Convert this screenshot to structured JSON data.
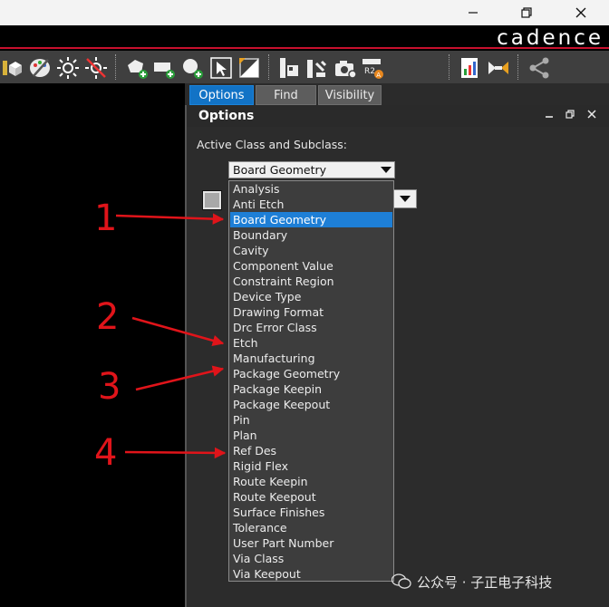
{
  "brand": "cadence",
  "tabs": [
    {
      "label": "Options",
      "active": true
    },
    {
      "label": "Find",
      "active": false
    },
    {
      "label": "Visibility",
      "active": false
    }
  ],
  "panel": {
    "title": "Options",
    "active_class_label": "Active Class and Subclass:",
    "class_value": "Board Geometry"
  },
  "dropdown_items": [
    "Analysis",
    "Anti Etch",
    "Board Geometry",
    "Boundary",
    "Cavity",
    "Component Value",
    "Constraint Region",
    "Device Type",
    "Drawing Format",
    "Drc Error Class",
    "Etch",
    "Manufacturing",
    "Package Geometry",
    "Package Keepin",
    "Package Keepout",
    "Pin",
    "Plan",
    "Ref Des",
    "Rigid Flex",
    "Route Keepin",
    "Route Keepout",
    "Surface Finishes",
    "Tolerance",
    "User Part Number",
    "Via Class",
    "Via Keepout"
  ],
  "selected_index": 2,
  "annotations": [
    "1",
    "2",
    "3",
    "4"
  ],
  "watermark": "公众号 · 子正电子科技",
  "colors": {
    "accent": "#1e7fd6",
    "annotation": "#e0141a",
    "brand_line": "#c8102e"
  },
  "icons": [
    "minimize-icon",
    "restore-icon",
    "close-icon",
    "panel-pin-icon",
    "panel-float-icon",
    "panel-close-icon",
    "chevron-down-icon"
  ]
}
